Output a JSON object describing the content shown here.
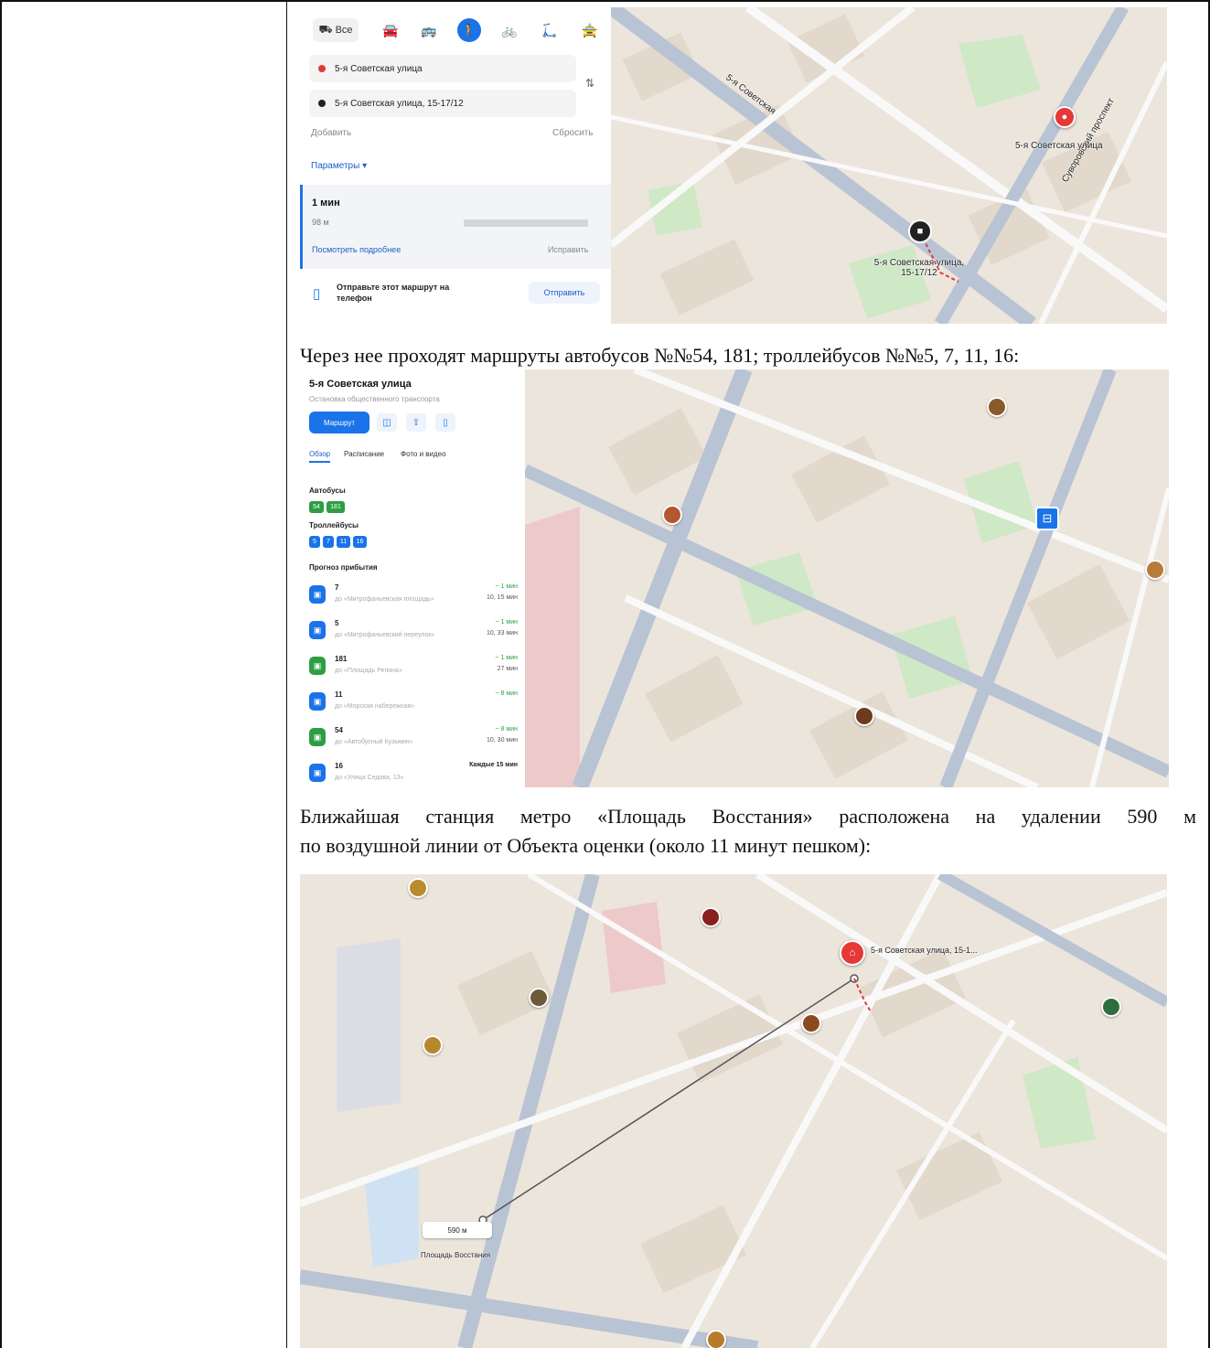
{
  "paragraphs": {
    "routes": "Через нее проходят маршруты автобусов №№54, 181; троллейбусов №№5, 7, 11, 16:",
    "metro_line1": "Ближайшая станция метро «Площадь Восстания» расположена на удалении 590 м",
    "metro_line2": "по воздушной линии от Объекта оценки (около 11 минут пешком):"
  },
  "route_panel": {
    "mode_all": "Все",
    "point_a": "5-я Советская улица",
    "point_b": "5-я Советская улица, 15-17/12",
    "add": "Добавить",
    "reset": "Сбросить",
    "params": "Параметры ▾",
    "time": "1 мин",
    "distance": "98 м",
    "details": "Посмотреть подробнее",
    "fix": "Исправить",
    "send_text": "Отправьте этот маршрут на телефон",
    "send_button": "Отправить"
  },
  "map1": {
    "street_a": "5-я Советская",
    "street_b": "Суворовский проспект",
    "pin_label_a": "5-я Советская улица",
    "pin_label_b": "5-я Советская улица, 15-17/12"
  },
  "stop_panel": {
    "title": "5-я Советская улица",
    "subtitle": "Остановка общественного транспорта",
    "route_btn": "Маршрут",
    "tabs": [
      "Обзор",
      "Расписание",
      "Фото и видео"
    ],
    "buses_h": "Автобусы",
    "buses": [
      "54",
      "181"
    ],
    "trolleys_h": "Троллейбусы",
    "trolleys": [
      "5",
      "7",
      "11",
      "16"
    ],
    "forecast_h": "Прогноз прибытия",
    "arrivals": [
      {
        "num": "7",
        "dir": "до «Митрофаньевская площадь»",
        "eta": "~ 1 мин",
        "eta2": "10, 15 мин",
        "color": "#1a73e8"
      },
      {
        "num": "5",
        "dir": "до «Митрофаньевский переулок»",
        "eta": "~ 1 мин",
        "eta2": "10, 33 мин",
        "color": "#1a73e8"
      },
      {
        "num": "181",
        "dir": "до «Площадь Репина»",
        "eta": "~ 1 мин",
        "eta2": "27 мин",
        "color": "#2e9e44"
      },
      {
        "num": "11",
        "dir": "до «Морская набережная»",
        "eta": "~ 8 мин",
        "eta2": "",
        "color": "#1a73e8"
      },
      {
        "num": "54",
        "dir": "до «Автобусный Кузьмин»",
        "eta": "~ 8 мин",
        "eta2": "10, 30 мин",
        "color": "#2e9e44"
      },
      {
        "num": "16",
        "dir": "до «Улица Седова, 13»",
        "every": "Каждые 15 мин",
        "color": "#1a73e8"
      }
    ]
  },
  "map3": {
    "dest_label": "5-я Советская улица, 15-1...",
    "distance_chip": "590 м",
    "metro_label": "Площадь Восстания"
  },
  "colors": {
    "map_bg": "#ece5dc",
    "road": "#f9f9f9",
    "main_road": "#b8c4d4",
    "park": "#cfe8c5",
    "accent_blue": "#1a73e8",
    "pin_red": "#e53935"
  }
}
